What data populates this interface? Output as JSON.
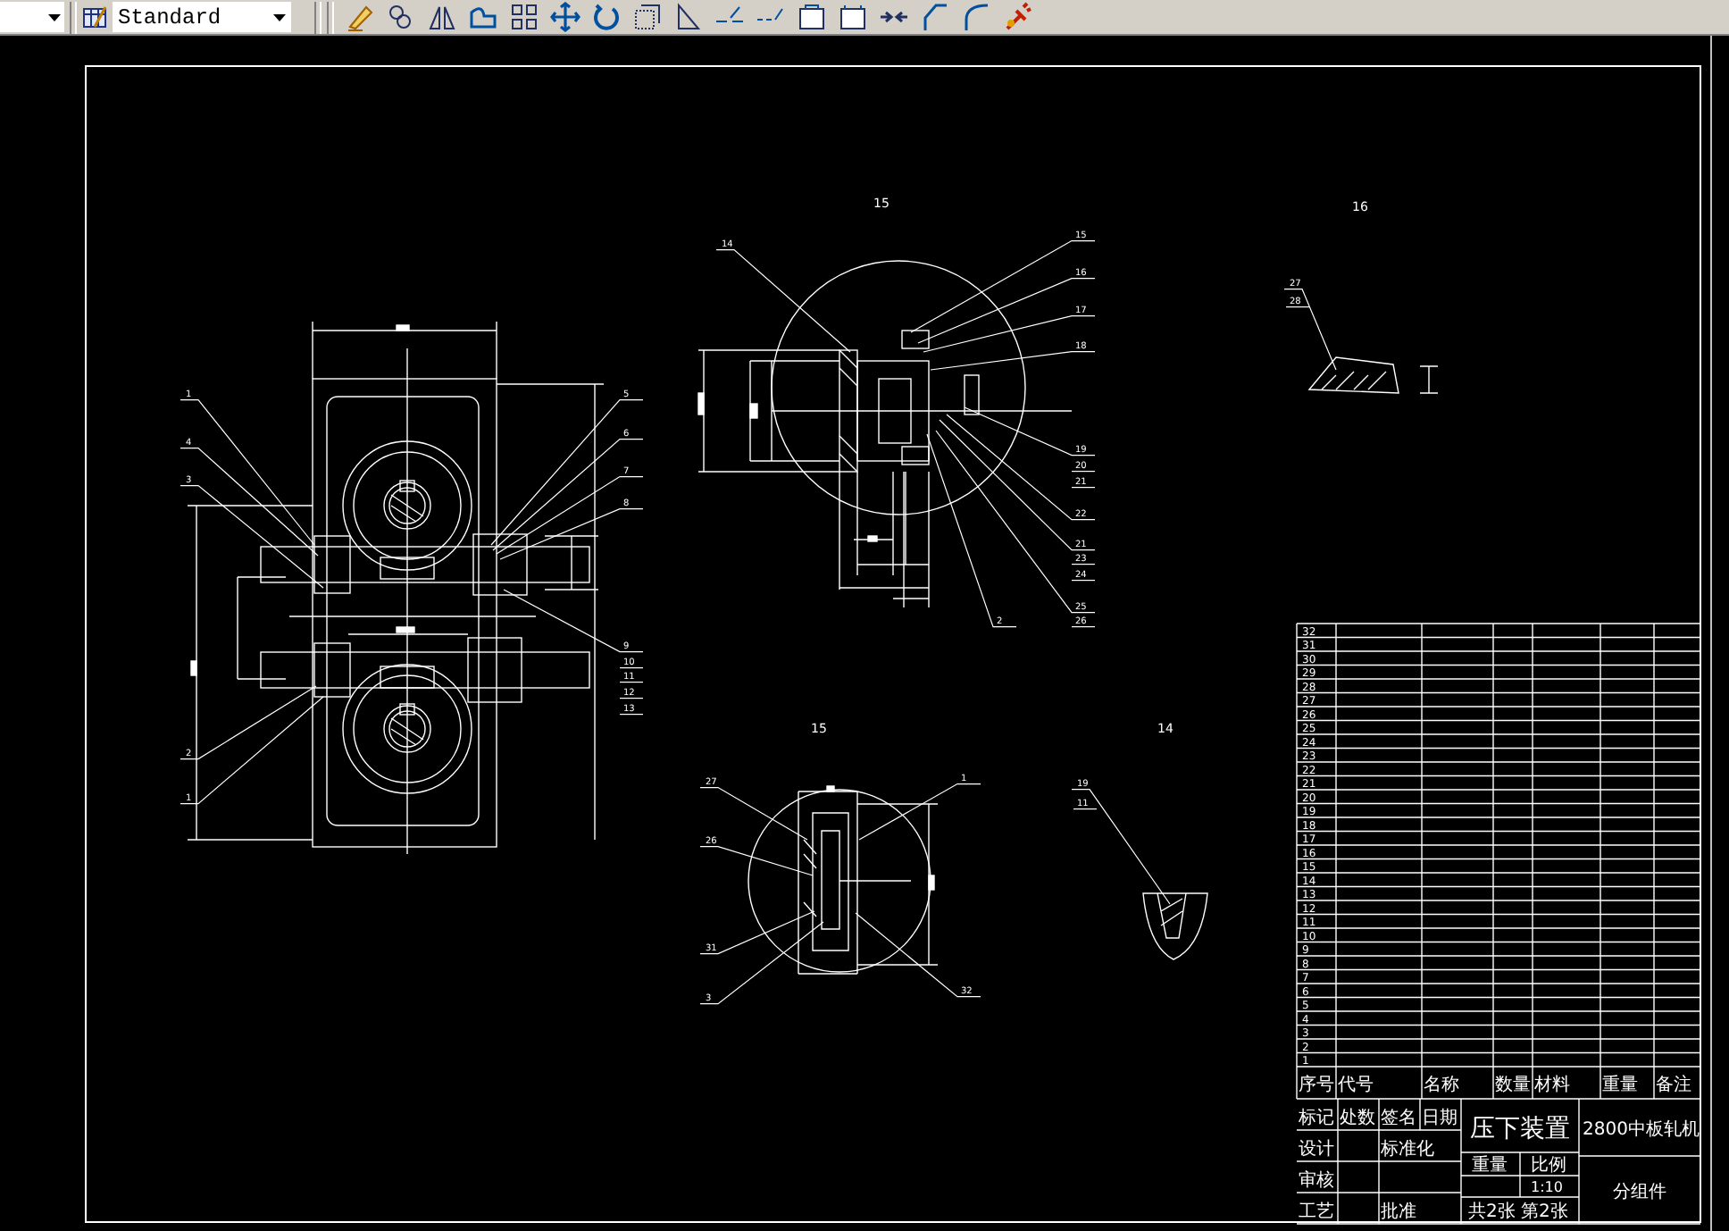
{
  "toolbar": {
    "style_dropdown": "Standard"
  },
  "main_view": {
    "balloons": [
      "1",
      "4",
      "3",
      "2",
      "1",
      "5",
      "6",
      "7",
      "8",
      "9",
      "10",
      "11",
      "12",
      "13"
    ]
  },
  "section_view": {
    "title": "15",
    "balloons": [
      "14",
      "15",
      "16",
      "17",
      "18",
      "19",
      "20",
      "21",
      "22",
      "21",
      "23",
      "24",
      "25",
      "26",
      "2"
    ]
  },
  "detail_view": {
    "title": "16",
    "balloons": [
      "27",
      "28"
    ]
  },
  "lower_section_view": {
    "title": "15",
    "balloons": [
      "27",
      "26",
      "31",
      "3",
      "1",
      "32"
    ]
  },
  "lower_detail_view": {
    "title": "14",
    "balloons": [
      "19",
      "11"
    ]
  },
  "parts_list": {
    "headers": [
      "序号",
      "代号",
      "名称",
      "数量",
      "材料",
      "重量",
      "备注"
    ],
    "rows": [
      "32",
      "31",
      "30",
      "29",
      "28",
      "27",
      "26",
      "25",
      "24",
      "23",
      "22",
      "21",
      "20",
      "19",
      "18",
      "17",
      "16",
      "15",
      "14",
      "13",
      "12",
      "11",
      "10",
      "9",
      "8",
      "7",
      "6",
      "5",
      "4",
      "3",
      "2",
      "1"
    ]
  },
  "title_block": {
    "grid_labels": [
      "标记",
      "处数",
      "签名",
      "日期",
      "设计",
      "标准化",
      "审核",
      "工艺",
      "批准"
    ],
    "title": "压下装置",
    "weight_label": "重量",
    "scale_label": "比例",
    "scale": "1:10",
    "sheets": "共2张 第2张",
    "project": "2800中板轧机",
    "drawing_type": "分组件"
  }
}
